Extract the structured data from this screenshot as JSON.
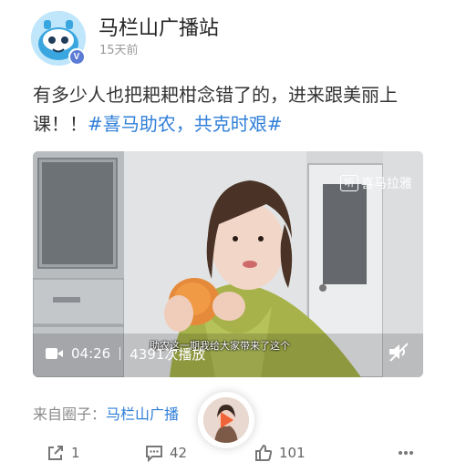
{
  "post": {
    "author": "马栏山广播站",
    "time": "15天前",
    "text": "有多少人也把耙耙柑念错了的，进来跟美丽上课！！",
    "tag": "#喜马助农，共克时艰#",
    "verified_badge": "V",
    "avatar_icon": "cartoon-face-avatar"
  },
  "video": {
    "brand": "喜马拉雅",
    "brand_icon": "听",
    "subtitle": "助农这一期我给大家带来了这个",
    "duration": "04:26",
    "plays": "4391次播放",
    "mute_icon": "volume-mute-icon"
  },
  "source": {
    "label": "来自圈子：",
    "circle": "马栏山广播"
  },
  "actions": {
    "share_count": "1",
    "comment_count": "42",
    "like_count": "101"
  },
  "colors": {
    "link": "#2f7fd8",
    "avatar_bg": "#bfe6fb",
    "verified": "#5b7bd6",
    "player_accent": "#f06439"
  }
}
